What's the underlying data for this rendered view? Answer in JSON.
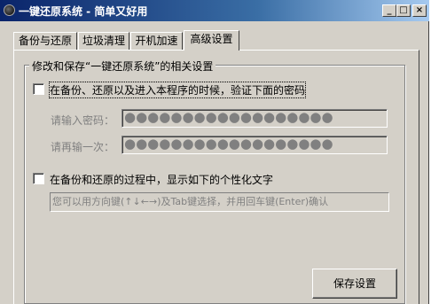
{
  "window": {
    "title": "一键还原系统 - 简单又好用",
    "min_glyph": "_",
    "max_glyph": "□",
    "close_glyph": "×"
  },
  "tabs": [
    {
      "label": "备份与还原",
      "active": false
    },
    {
      "label": "垃圾清理",
      "active": false
    },
    {
      "label": "开机加速",
      "active": false
    },
    {
      "label": "高级设置",
      "active": true
    }
  ],
  "group": {
    "legend": "修改和保存“一键还原系统”的相关设置"
  },
  "password": {
    "checkbox_label": "在备份、还原以及进入本程序的时候，验证下面的密码",
    "checked": false,
    "field1_label": "请输入密码：",
    "field1_value": "●●●●●●●●●●●●●●●●●●",
    "field2_label": "请再输一次：",
    "field2_value": "●●●●●●●●●●●●●●●●●●"
  },
  "custom_text": {
    "checkbox_label": "在备份和还原的过程中，显示如下的个性化文字",
    "checked": false,
    "value": "您可以用方向键(↑↓←→)及Tab键选择，并用回车键(Enter)确认"
  },
  "save_button_label": "保存设置",
  "colors": {
    "titlebar_start": "#0a246a",
    "titlebar_end": "#a6caf0",
    "face": "#d4d0c8",
    "disabled_text": "#808080"
  }
}
